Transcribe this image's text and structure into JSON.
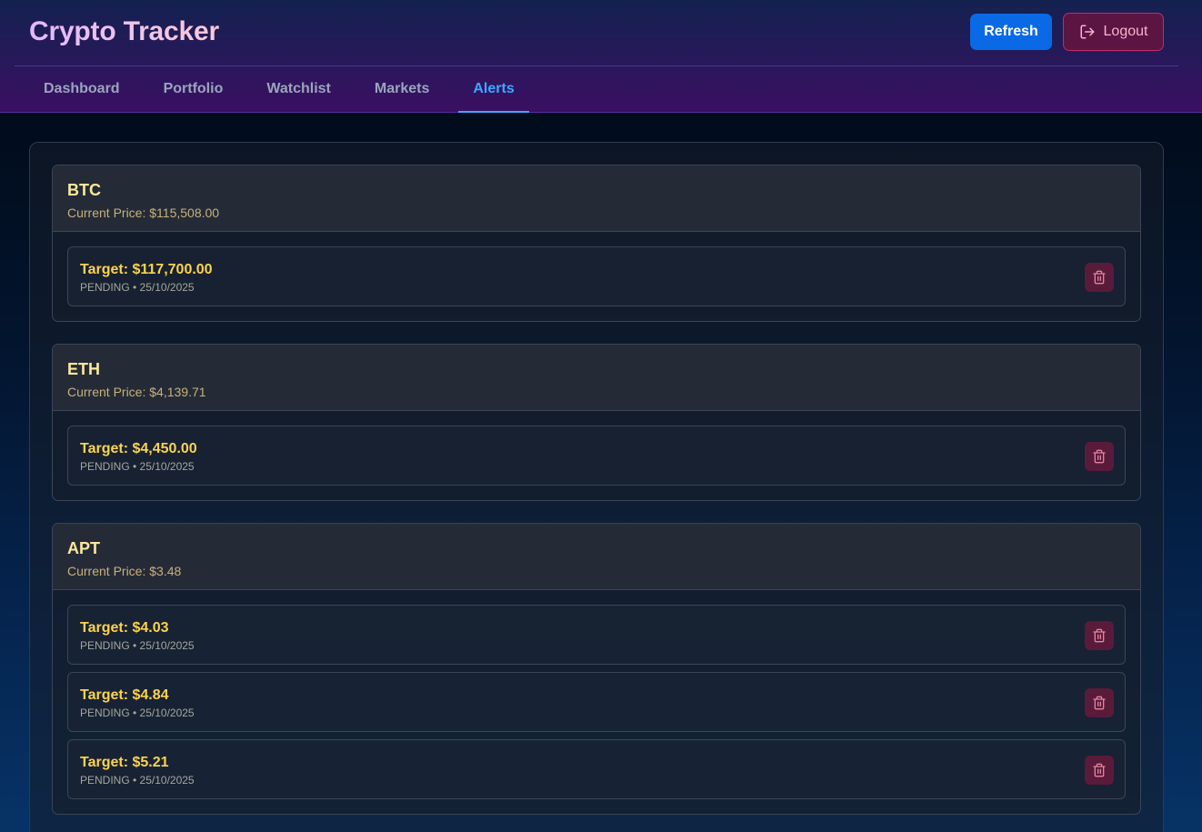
{
  "header": {
    "title": "Crypto Tracker",
    "refresh_label": "Refresh",
    "logout_label": "Logout"
  },
  "tabs": [
    {
      "label": "Dashboard",
      "active": false
    },
    {
      "label": "Portfolio",
      "active": false
    },
    {
      "label": "Watchlist",
      "active": false
    },
    {
      "label": "Markets",
      "active": false
    },
    {
      "label": "Alerts",
      "active": true
    }
  ],
  "coins": [
    {
      "symbol": "BTC",
      "current_price": "Current Price: $115,508.00",
      "alerts": [
        {
          "target": "Target: $117,700.00",
          "meta": "PENDING • 25/10/2025"
        }
      ]
    },
    {
      "symbol": "ETH",
      "current_price": "Current Price: $4,139.71",
      "alerts": [
        {
          "target": "Target: $4,450.00",
          "meta": "PENDING • 25/10/2025"
        }
      ]
    },
    {
      "symbol": "APT",
      "current_price": "Current Price: $3.48",
      "alerts": [
        {
          "target": "Target: $4.03",
          "meta": "PENDING • 25/10/2025"
        },
        {
          "target": "Target: $4.84",
          "meta": "PENDING • 25/10/2025"
        },
        {
          "target": "Target: $5.21",
          "meta": "PENDING • 25/10/2025"
        }
      ]
    }
  ],
  "icons": {
    "logout": "logout-icon",
    "delete": "trash-icon"
  },
  "colors": {
    "accent": "#3ea7ff",
    "refresh_button": "#0a6ae6",
    "logout_border": "#c22a68",
    "symbol": "#fde89a",
    "target": "#fcd34d"
  }
}
